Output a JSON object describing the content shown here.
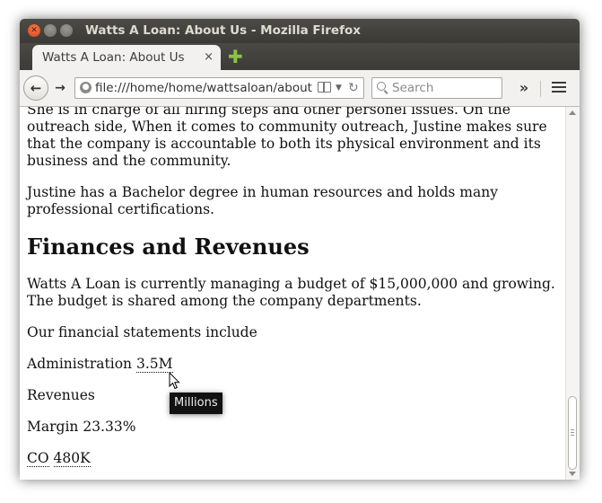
{
  "window": {
    "title": "Watts A Loan: About Us - Mozilla Firefox"
  },
  "tab": {
    "label": "Watts A Loan: About Us",
    "close_glyph": "×",
    "new_tab_glyph": "✚"
  },
  "navbar": {
    "url": "file:///home/home/wattsaloan/about",
    "search_placeholder": "Search",
    "overflow_glyph": "»"
  },
  "page": {
    "paragraphs_intro": [
      "She is in charge of all hiring steps and other personel issues. On the outreach side, When it comes to community outreach, Justine makes sure that the company is accountable to both its physical environment and its business and the community.",
      "Justine has a Bachelor degree in human resources and holds many professional certifications."
    ],
    "heading": "Finances and Revenues",
    "paragraphs_finance": [
      "Watts A Loan is currently managing a budget of $15,000,000 and growing. The budget is shared among the company departments.",
      "Our financial statements include"
    ],
    "administration": {
      "label": "Administration",
      "value": "3.5M"
    },
    "revenues": {
      "label": "Revenues"
    },
    "margin": {
      "label": "Margin",
      "value": "23.33%"
    },
    "co": {
      "abbr": "CO",
      "value": "480K"
    }
  },
  "tooltip": {
    "text": "Millions"
  },
  "colors": {
    "titlebar": "#3c3b37",
    "close_button": "#e0541f",
    "new_tab": "#8bc24a",
    "tooltip_bg": "#111111"
  }
}
